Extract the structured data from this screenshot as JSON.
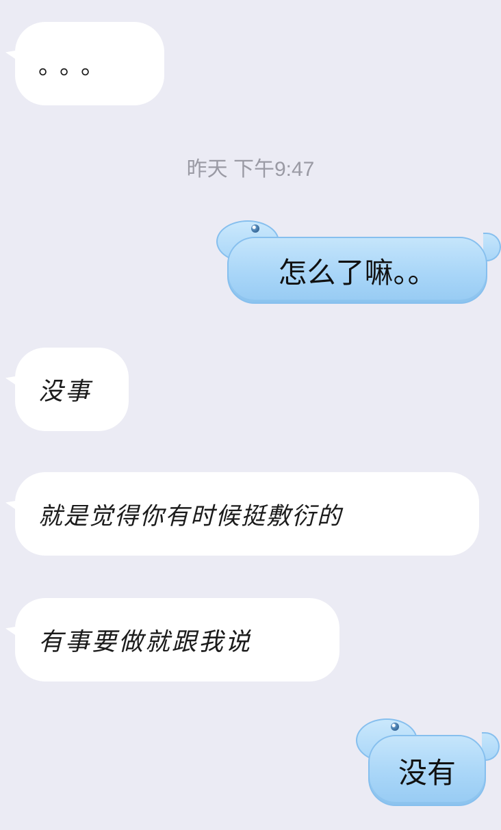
{
  "chat": {
    "timestamp": "昨天 下午9:47",
    "messages": [
      {
        "side": "received",
        "text": "。。。"
      },
      {
        "side": "sent",
        "text": "怎么了嘛。。"
      },
      {
        "side": "received",
        "text": "没事"
      },
      {
        "side": "received",
        "text": "就是觉得你有时候挺敷衍的"
      },
      {
        "side": "received",
        "text": "有事要做就跟我说"
      },
      {
        "side": "sent",
        "text": "没有"
      }
    ]
  },
  "colors": {
    "background": "#ebebf4",
    "received_bubble": "#ffffff",
    "sent_bubble": "#a9d6f8",
    "timestamp_text": "#9a9aa4"
  }
}
